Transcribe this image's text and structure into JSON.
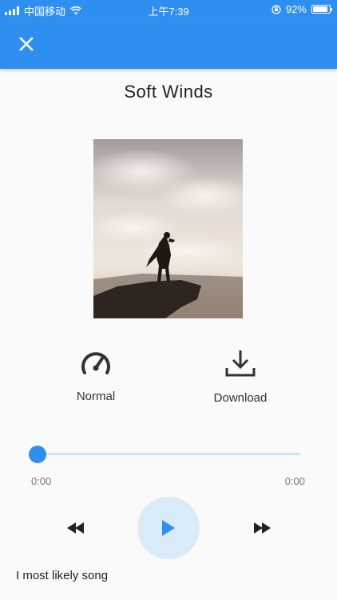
{
  "status_bar": {
    "carrier": "中国移动",
    "time": "上午7:39",
    "battery": "92%",
    "battery_level": 0.92
  },
  "app_bar": {
    "close_icon": "close-icon"
  },
  "track": {
    "title": "Soft Winds"
  },
  "actions": {
    "speed_label": "Normal",
    "speed_icon": "speedometer-icon",
    "download_label": "Download",
    "download_icon": "download-icon"
  },
  "player": {
    "progress": 0,
    "current_time": "0:00",
    "duration": "0:00",
    "rewind_icon": "rewind-icon",
    "play_icon": "play-icon",
    "forward_icon": "fast-forward-icon"
  },
  "lyrics": {
    "line": "I most likely song"
  },
  "colors": {
    "primary": "#2f8ff0",
    "track_bg": "#cde4fb",
    "play_bg": "#d9eaf9",
    "background": "#fafafa"
  }
}
